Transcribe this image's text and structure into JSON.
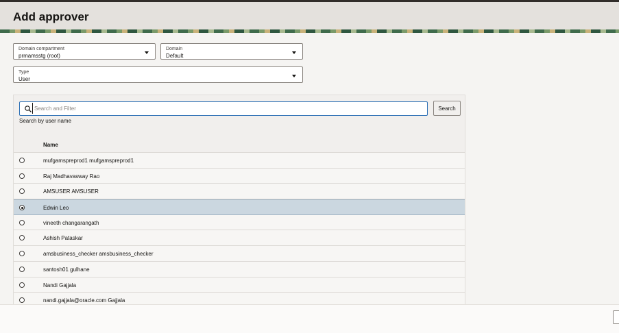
{
  "page": {
    "title": "Add approver"
  },
  "domain_compartment": {
    "label": "Domain compartment",
    "value": "prmamsstg (root)"
  },
  "domain": {
    "label": "Domain",
    "value": "Default"
  },
  "type": {
    "label": "Type",
    "value": "User"
  },
  "search": {
    "placeholder": "Search and Filter",
    "button_label": "Search",
    "hint": "Search by user name"
  },
  "table": {
    "column_name": "Name",
    "rows": [
      {
        "name": "mufgamspreprod1 mufgamspreprod1",
        "selected": false
      },
      {
        "name": "Raj Madhavasway Rao",
        "selected": false
      },
      {
        "name": "AMSUSER AMSUSER",
        "selected": false
      },
      {
        "name": "Edwin Leo",
        "selected": true
      },
      {
        "name": "vineeth changarangath",
        "selected": false
      },
      {
        "name": "Ashish Pataskar",
        "selected": false
      },
      {
        "name": "amsbusiness_checker amsbusiness_checker",
        "selected": false
      },
      {
        "name": "santosh01 gulhane",
        "selected": false
      },
      {
        "name": "Nandi Gajjala",
        "selected": false
      },
      {
        "name": "nandi.gajjala@oracle.com Gajjala",
        "selected": false
      }
    ]
  },
  "colors": {
    "accent": "#2c6fb5",
    "selected_row": "#cbd7e0",
    "header_bg": "#e4e1dd"
  },
  "icons": {
    "search": "search-icon",
    "dropdown": "chevron-down-icon"
  }
}
